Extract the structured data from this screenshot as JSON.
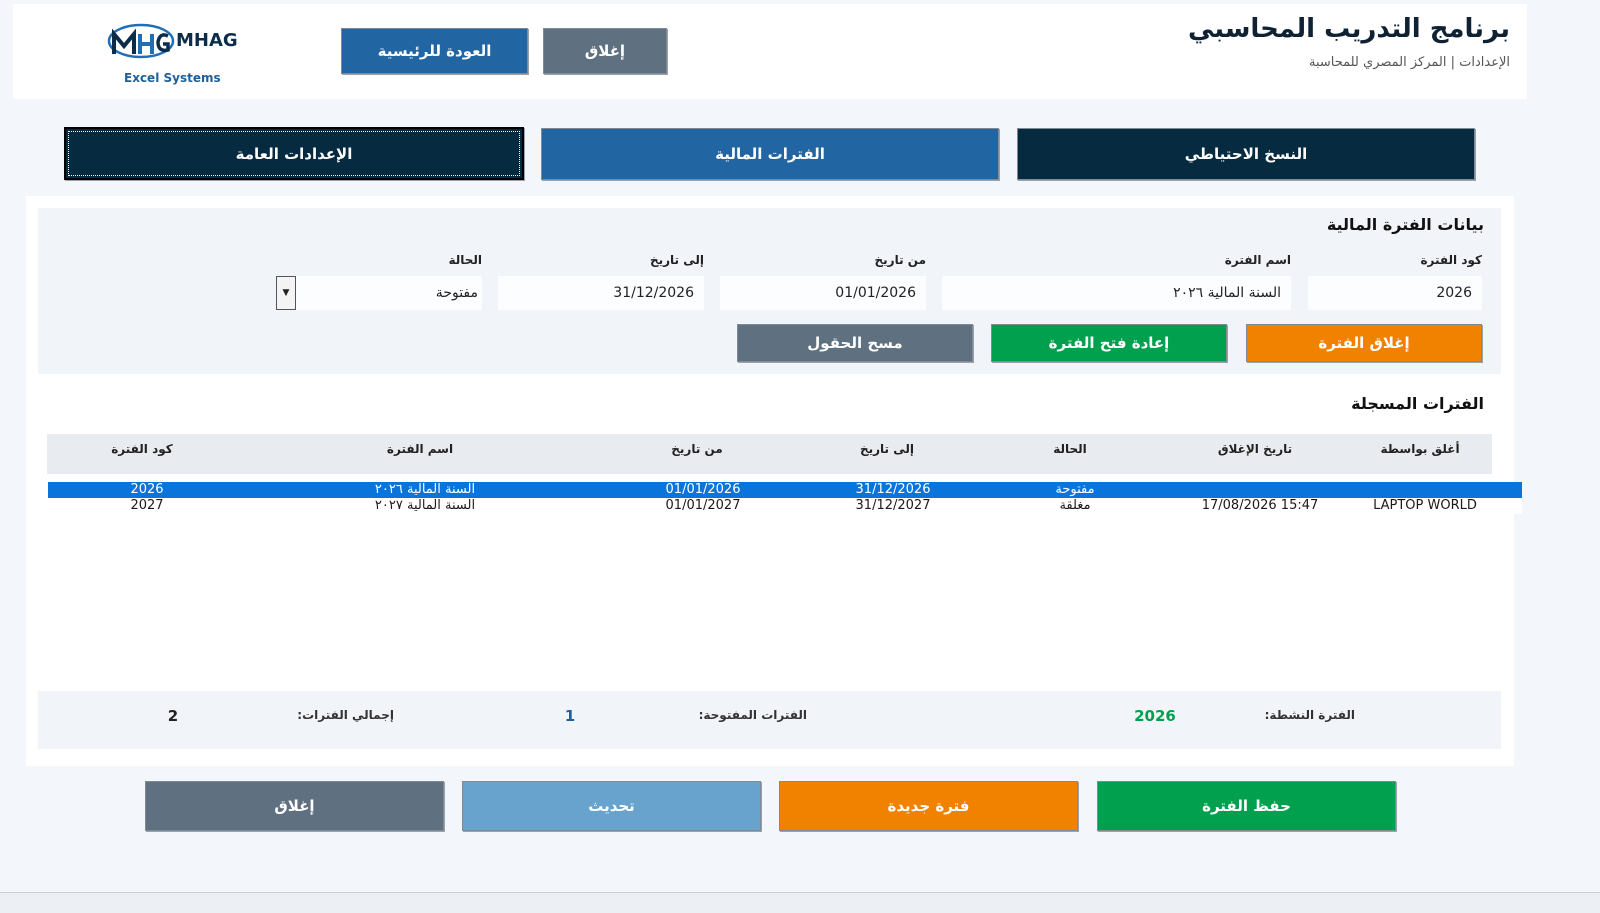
{
  "header": {
    "title": "برنامج التدريب المحاسبي",
    "subtitle": "الإعدادات | المركز المصري للمحاسبة",
    "home_button": "العودة للرئيسية",
    "close_button": "إغلاق",
    "logo_text": "MHAG",
    "logo_sub": "Excel Systems"
  },
  "tabs": [
    {
      "label": "النسخ الاحتياطي"
    },
    {
      "label": "الفترات المالية"
    },
    {
      "label": "الإعدادات العامة"
    }
  ],
  "form": {
    "section_title": "بيانات الفترة المالية",
    "code_label": "كود الفترة",
    "code_value": "2026",
    "name_label": "اسم الفترة",
    "name_value": "السنة المالية ٢٠٢٦",
    "from_label": "من تاريخ",
    "from_value": "01/01/2026",
    "to_label": "إلى تاريخ",
    "to_value": "31/12/2026",
    "status_label": "الحالة",
    "status_value": "مفتوحة",
    "close_period_button": "إغلاق الفترة",
    "reopen_period_button": "إعادة فتح الفترة",
    "clear_fields_button": "مسح الحقول"
  },
  "list": {
    "section_title": "الفترات المسجلة",
    "columns": {
      "closed_by": "أغلق بواسطة",
      "close_date": "تاريخ الإغلاق",
      "status": "الحالة",
      "to_date": "إلى تاريخ",
      "from_date": "من تاريخ",
      "name": "اسم الفترة",
      "code": "كود الفترة"
    },
    "rows": [
      {
        "closed_by": "",
        "close_date": "",
        "status": "مفتوحة",
        "to_date": "31/12/2026",
        "from_date": "01/01/2026",
        "name": "السنة المالية ٢٠٢٦",
        "code": "2026"
      },
      {
        "closed_by": "LAPTOP WORLD",
        "close_date": "17/08/2026 15:47",
        "status": "مغلقة",
        "to_date": "31/12/2027",
        "from_date": "01/01/2027",
        "name": "السنة المالية ٢٠٢٧",
        "code": "2027"
      }
    ]
  },
  "summary": {
    "active_label": "الفترة النشطة:",
    "active_value": "2026",
    "open_label": "الفترات المفتوحة:",
    "open_value": "1",
    "total_label": "إجمالي الفترات:",
    "total_value": "2"
  },
  "footer": {
    "save_button": "حفظ الفترة",
    "new_button": "فترة جديدة",
    "refresh_button": "تحديث",
    "close_button": "إغلاق"
  },
  "colors": {
    "navy": "#062a40",
    "blue": "#2166a3",
    "green": "#00a04f",
    "orange": "#f08200",
    "slate": "#5f7080",
    "light_blue": "#67a3cc",
    "selected_row": "#0a74da"
  }
}
